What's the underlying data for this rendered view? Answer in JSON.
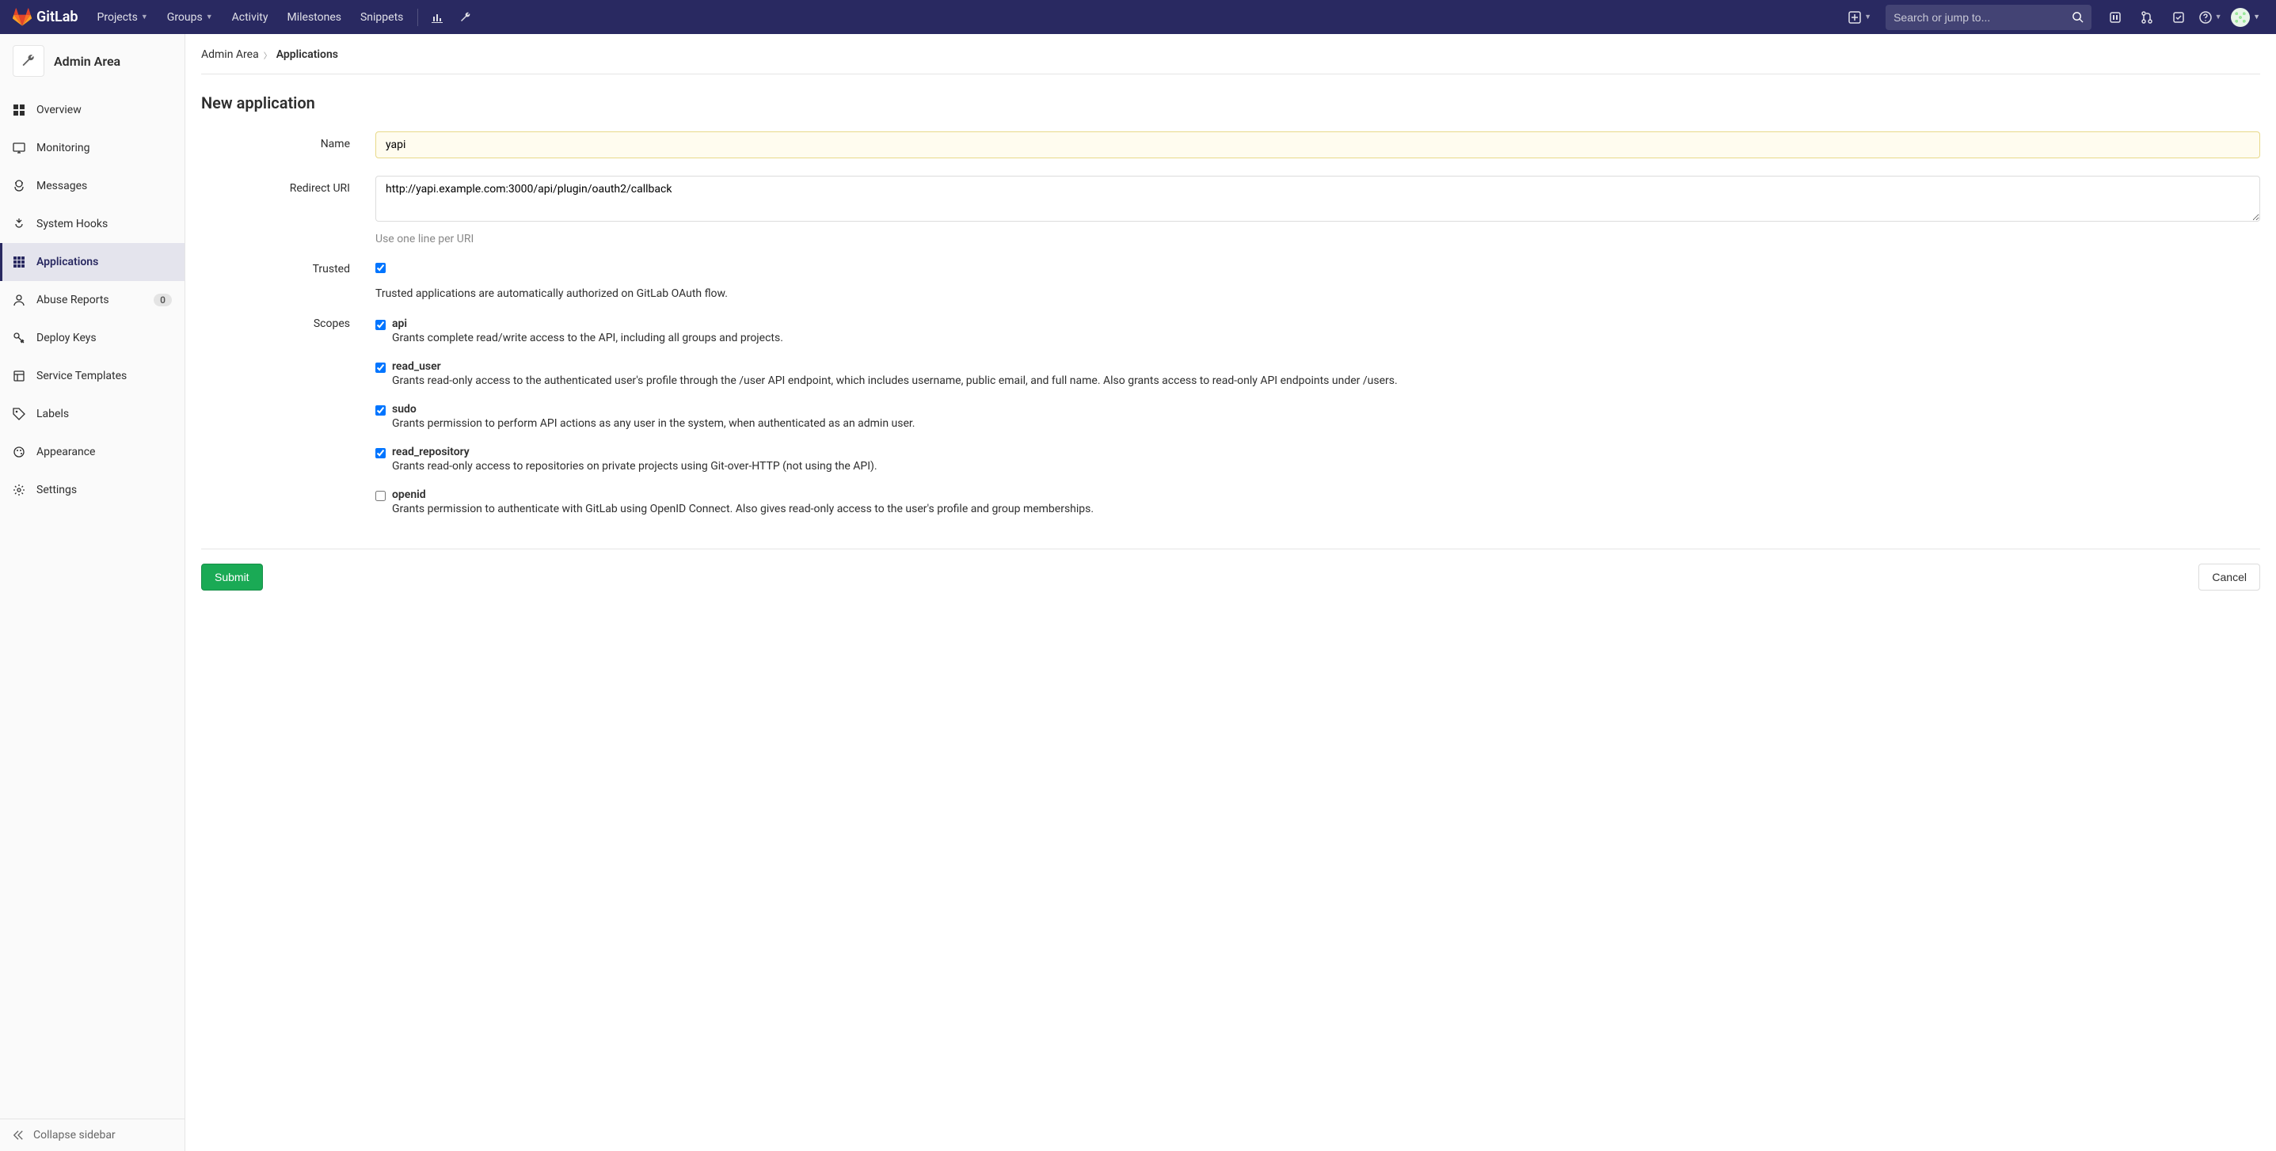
{
  "brand": {
    "name": "GitLab"
  },
  "navbar": {
    "items": [
      {
        "label": "Projects",
        "has_dropdown": true
      },
      {
        "label": "Groups",
        "has_dropdown": true
      },
      {
        "label": "Activity",
        "has_dropdown": false
      },
      {
        "label": "Milestones",
        "has_dropdown": false
      },
      {
        "label": "Snippets",
        "has_dropdown": false
      }
    ],
    "search_placeholder": "Search or jump to..."
  },
  "sidebar": {
    "header": "Admin Area",
    "items": [
      {
        "label": "Overview",
        "icon": "overview"
      },
      {
        "label": "Monitoring",
        "icon": "monitoring"
      },
      {
        "label": "Messages",
        "icon": "messages"
      },
      {
        "label": "System Hooks",
        "icon": "hooks"
      },
      {
        "label": "Applications",
        "icon": "apps",
        "active": true
      },
      {
        "label": "Abuse Reports",
        "icon": "abuse",
        "badge": "0"
      },
      {
        "label": "Deploy Keys",
        "icon": "key"
      },
      {
        "label": "Service Templates",
        "icon": "template"
      },
      {
        "label": "Labels",
        "icon": "labels"
      },
      {
        "label": "Appearance",
        "icon": "appearance"
      },
      {
        "label": "Settings",
        "icon": "settings"
      }
    ],
    "collapse": "Collapse sidebar"
  },
  "breadcrumb": {
    "root": "Admin Area",
    "current": "Applications"
  },
  "page": {
    "title": "New application"
  },
  "form": {
    "name_label": "Name",
    "name_value": "yapi",
    "redirect_label": "Redirect URI",
    "redirect_value": "http://yapi.example.com:3000/api/plugin/oauth2/callback",
    "redirect_help": "Use one line per URI",
    "trusted_label": "Trusted",
    "trusted_help": "Trusted applications are automatically authorized on GitLab OAuth flow.",
    "trusted_checked": true,
    "scopes_label": "Scopes",
    "scopes": [
      {
        "name": "api",
        "desc": "Grants complete read/write access to the API, including all groups and projects.",
        "checked": true
      },
      {
        "name": "read_user",
        "desc": "Grants read-only access to the authenticated user's profile through the /user API endpoint, which includes username, public email, and full name. Also grants access to read-only API endpoints under /users.",
        "checked": true
      },
      {
        "name": "sudo",
        "desc": "Grants permission to perform API actions as any user in the system, when authenticated as an admin user.",
        "checked": true
      },
      {
        "name": "read_repository",
        "desc": "Grants read-only access to repositories on private projects using Git-over-HTTP (not using the API).",
        "checked": true
      },
      {
        "name": "openid",
        "desc": "Grants permission to authenticate with GitLab using OpenID Connect. Also gives read-only access to the user's profile and group memberships.",
        "checked": false
      }
    ],
    "submit": "Submit",
    "cancel": "Cancel"
  }
}
